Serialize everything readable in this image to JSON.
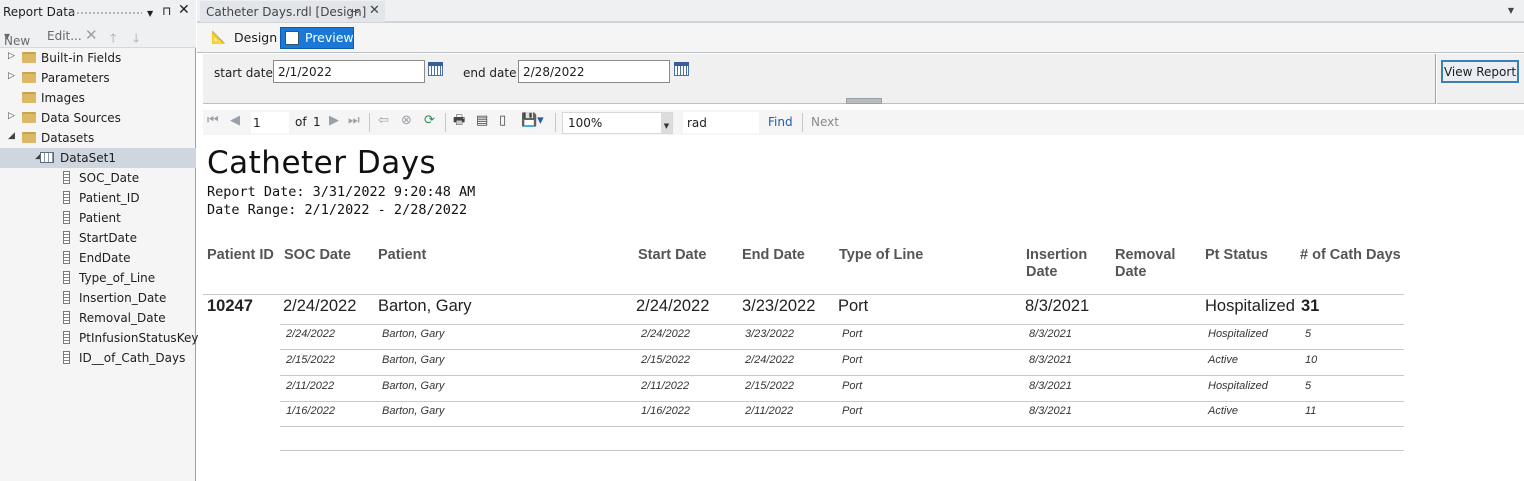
{
  "left_panel": {
    "title": "Report Data",
    "toolbar": {
      "new_label": "New",
      "edit_label": "Edit..."
    },
    "tree": [
      {
        "label": "Built-in Fields",
        "kind": "folder",
        "expander": "closed",
        "indent": 0
      },
      {
        "label": "Parameters",
        "kind": "folder",
        "expander": "closed",
        "indent": 0
      },
      {
        "label": "Images",
        "kind": "folder",
        "expander": "none",
        "indent": 0
      },
      {
        "label": "Data Sources",
        "kind": "folder",
        "expander": "closed",
        "indent": 0
      },
      {
        "label": "Datasets",
        "kind": "folder",
        "expander": "open",
        "indent": 0
      },
      {
        "label": "DataSet1",
        "kind": "dataset",
        "expander": "open",
        "indent": 1,
        "selected": true
      },
      {
        "label": "SOC_Date",
        "kind": "field",
        "indent": 2
      },
      {
        "label": "Patient_ID",
        "kind": "field",
        "indent": 2
      },
      {
        "label": "Patient",
        "kind": "field",
        "indent": 2
      },
      {
        "label": "StartDate",
        "kind": "field",
        "indent": 2
      },
      {
        "label": "EndDate",
        "kind": "field",
        "indent": 2
      },
      {
        "label": "Type_of_Line",
        "kind": "field",
        "indent": 2
      },
      {
        "label": "Insertion_Date",
        "kind": "field",
        "indent": 2
      },
      {
        "label": "Removal_Date",
        "kind": "field",
        "indent": 2
      },
      {
        "label": "PtInfusionStatusKey",
        "kind": "field",
        "indent": 2
      },
      {
        "label": "ID__of_Cath_Days",
        "kind": "field",
        "indent": 2
      }
    ]
  },
  "doc_tab": {
    "title": "Catheter Days.rdl [Design]"
  },
  "modes": {
    "design_label": "Design",
    "preview_label": "Preview",
    "active": "Preview"
  },
  "params": {
    "start_label": "start date",
    "start_value": "2/1/2022",
    "end_label": "end date",
    "end_value": "2/28/2022",
    "view_report_label": "View Report"
  },
  "toolbar": {
    "page_value": "1",
    "of_label": "of",
    "total_pages": "1",
    "zoom": "100%",
    "find_value": "rad",
    "find_label": "Find",
    "next_label": "Next"
  },
  "report": {
    "title": "Catheter Days",
    "report_date": "Report Date: 3/31/2022 9:20:48 AM",
    "date_range": "Date Range: 2/1/2022 - 2/28/2022",
    "headers": [
      "Patient ID",
      "SOC Date",
      "Patient",
      "Start Date",
      "End Date",
      "Type of Line",
      "Insertion\nDate",
      "Removal\nDate",
      "Pt Status",
      "# of Cath Days"
    ],
    "main_row": {
      "patient_id": "10247",
      "soc_date": "2/24/2022",
      "patient": "Barton, Gary",
      "start_date": "2/24/2022",
      "end_date": "3/23/2022",
      "type_of_line": "Port",
      "insertion_date": "8/3/2021",
      "removal_date": "",
      "pt_status": "Hospitalized",
      "cath_days": "31"
    },
    "detail_rows": [
      {
        "soc_date": "2/24/2022",
        "patient": "Barton, Gary",
        "start_date": "2/24/2022",
        "end_date": "3/23/2022",
        "type_of_line": "Port",
        "insertion_date": "8/3/2021",
        "pt_status": "Hospitalized",
        "cath_days": "5"
      },
      {
        "soc_date": "2/15/2022",
        "patient": "Barton, Gary",
        "start_date": "2/15/2022",
        "end_date": "2/24/2022",
        "type_of_line": "Port",
        "insertion_date": "8/3/2021",
        "pt_status": "Active",
        "cath_days": "10"
      },
      {
        "soc_date": "2/11/2022",
        "patient": "Barton, Gary",
        "start_date": "2/11/2022",
        "end_date": "2/15/2022",
        "type_of_line": "Port",
        "insertion_date": "8/3/2021",
        "pt_status": "Hospitalized",
        "cath_days": "5"
      },
      {
        "soc_date": "1/16/2022",
        "patient": "Barton, Gary",
        "start_date": "1/16/2022",
        "end_date": "2/11/2022",
        "type_of_line": "Port",
        "insertion_date": "8/3/2021",
        "pt_status": "Active",
        "cath_days": "11"
      }
    ]
  },
  "colors": {
    "accent": "#1a79d6",
    "selection": "#cfd6e0",
    "header_text": "#555555"
  }
}
